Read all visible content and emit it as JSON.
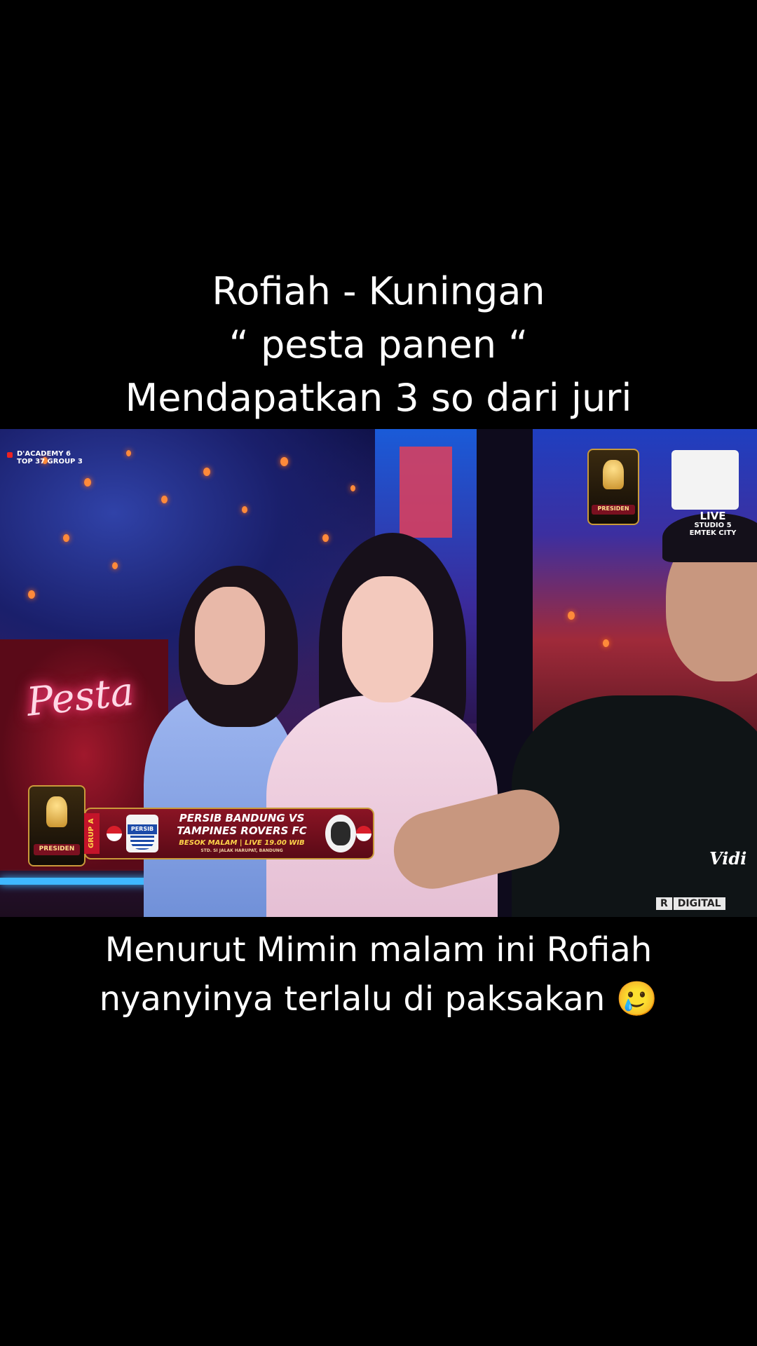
{
  "caption_top": {
    "line1": "Rofiah - Kuningan",
    "line2": "“ pesta panen “",
    "line3": "Mendapatkan 3 so dari juri"
  },
  "caption_bottom": {
    "line1": "Menurut Mimin malam ini Rofiah",
    "line2": "nyanyinya terlalu di paksakan 🥲"
  },
  "video": {
    "program_tag": {
      "line1": "D'ACADEMY 6",
      "line2": "TOP 37 GROUP 3"
    },
    "trophy_logo_text": "PRESIDEN",
    "live_badge": {
      "label": "LIVE",
      "location_line1": "STUDIO 5",
      "location_line2": "EMTEK CITY"
    },
    "neon_sign": "Pesta",
    "match_banner": {
      "group": "GRUP A",
      "team_left_badge": "PERSIB",
      "match_line1": "PERSIB BANDUNG VS",
      "match_line2": "TAMPINES ROVERS FC",
      "schedule": "BESOK MALAM | LIVE 19.00 WIB",
      "venue": "STD. SI JALAK HARUPAT, BANDUNG",
      "logo_text": "PRESIDEN"
    },
    "watermark": "Vidi",
    "rating": "R",
    "channel": "DIGITAL"
  },
  "colors": {
    "background": "#000000",
    "caption_text": "#ffffff",
    "banner_red": "#8a1424",
    "banner_gold": "#c99a3a"
  }
}
